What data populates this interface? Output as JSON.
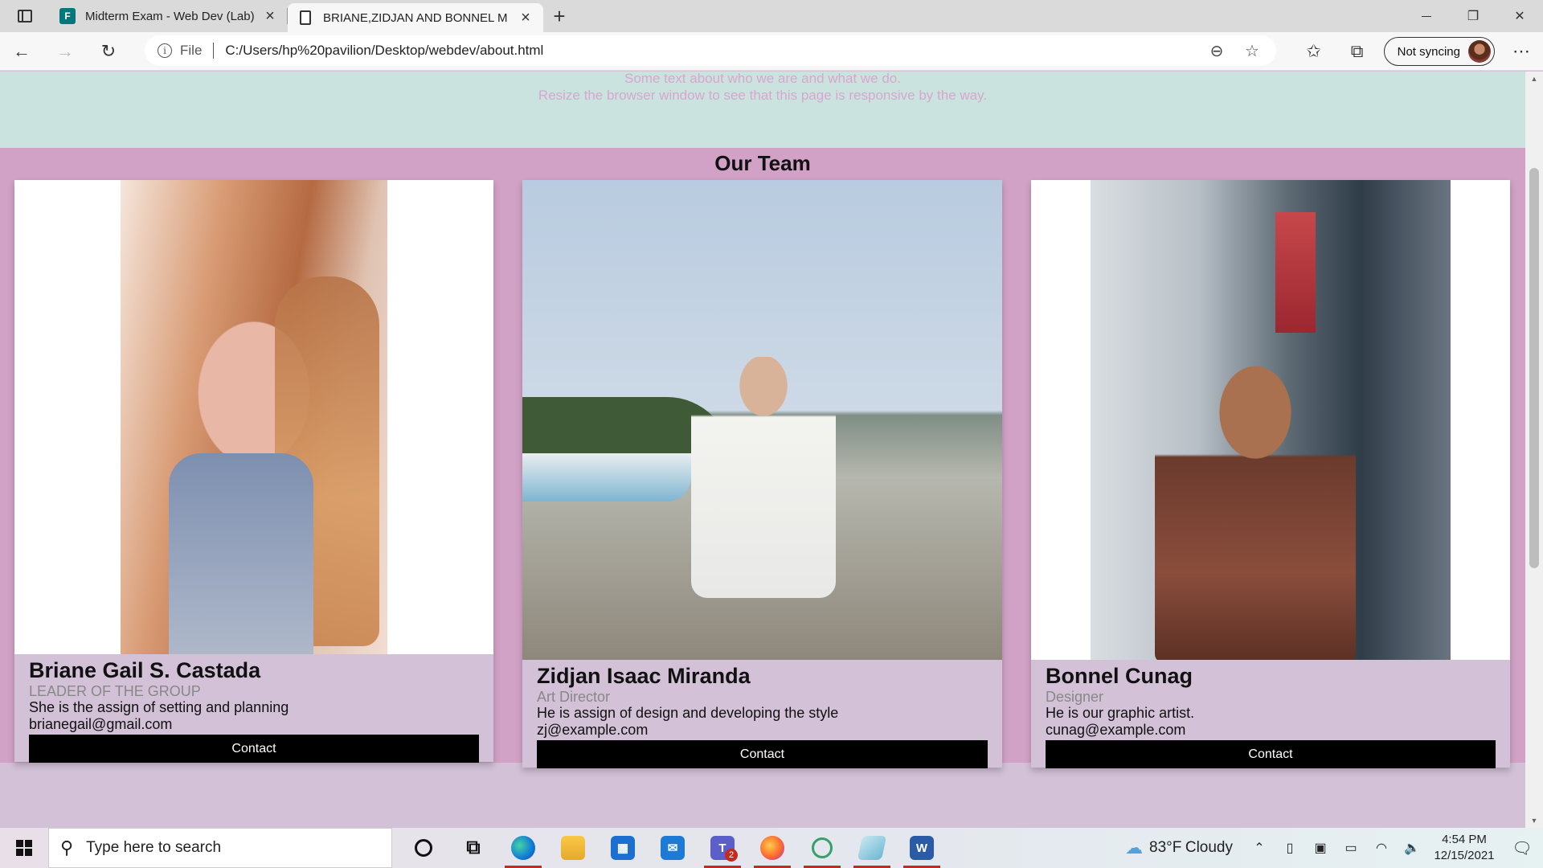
{
  "browser": {
    "tabs": [
      {
        "title": "Midterm Exam - Web Dev (Lab) |",
        "active": false,
        "icon": "forms-icon"
      },
      {
        "title": "BRIANE,ZIDJAN AND BONNEL M",
        "active": true,
        "icon": "file-icon"
      }
    ],
    "omnibox": {
      "scheme": "File",
      "url": "C:/Users/hp%20pavilion/Desktop/webdev/about.html"
    },
    "sync_label": "Not syncing"
  },
  "page": {
    "header": {
      "line1": "Some text about who we are and what we do.",
      "line2": "Resize the browser window to see that this page is responsive by the way."
    },
    "team_title": "Our Team",
    "members": [
      {
        "name": "Briane Gail S. Castada",
        "role": "LEADER OF THE GROUP",
        "description": "She is the assign of setting and planning",
        "email": "brianegail@gmail.com",
        "button": "Contact"
      },
      {
        "name": "Zidjan Isaac Miranda",
        "role": "Art Director",
        "description": "He is assign of design and developing the style",
        "email": "zj@example.com",
        "button": "Contact"
      },
      {
        "name": "Bonnel Cunag",
        "role": "Designer",
        "description": "He is our graphic artist.",
        "email": "cunag@example.com",
        "button": "Contact"
      }
    ],
    "colors": {
      "header_bg": "#cae3df",
      "team_bg": "#d1a2c6",
      "card_bg": "#d2c1d7",
      "button_bg": "#000000"
    }
  },
  "taskbar": {
    "search_placeholder": "Type here to search",
    "teams_badge": "2",
    "weather": {
      "temp": "83°F",
      "condition": "Cloudy"
    },
    "time": "4:54 PM",
    "date": "12/15/2021"
  }
}
